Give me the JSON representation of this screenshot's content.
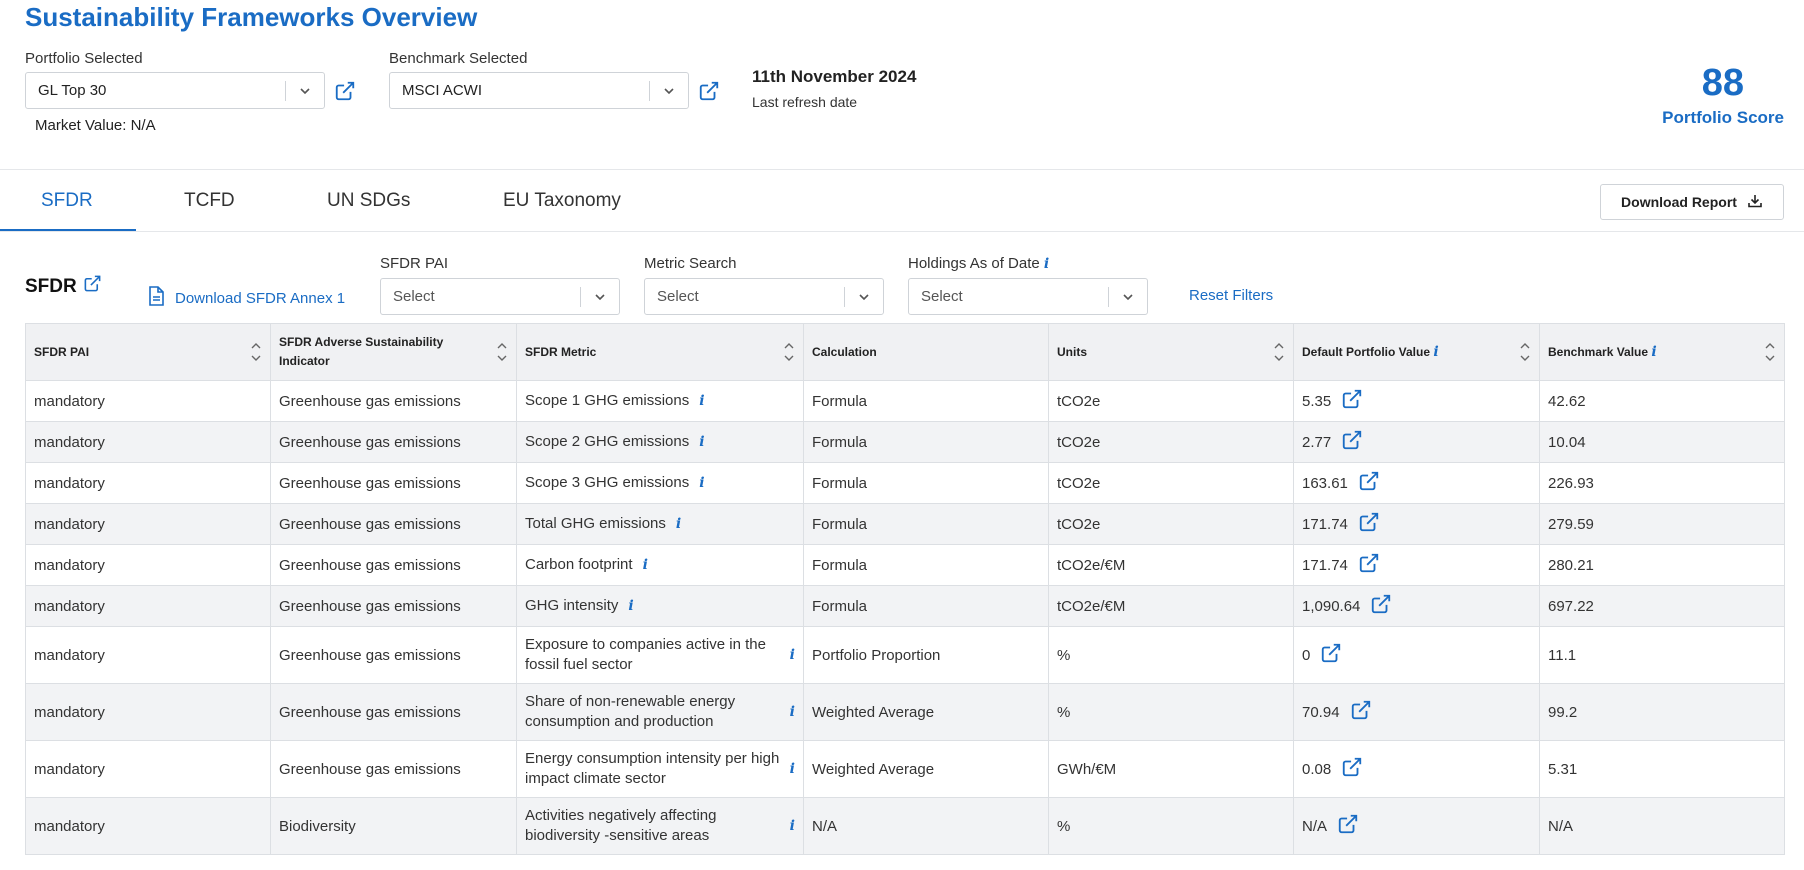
{
  "header": {
    "title": "Sustainability Frameworks Overview",
    "portfolio_label": "Portfolio Selected",
    "portfolio_value": "GL Top 30",
    "benchmark_label": "Benchmark Selected",
    "benchmark_value": "MSCI ACWI",
    "refresh_date": "11th November 2024",
    "refresh_label": "Last refresh date",
    "market_value": "Market Value: N/A",
    "score": "88",
    "score_label": "Portfolio Score"
  },
  "tabs": [
    {
      "label": "SFDR",
      "active": true
    },
    {
      "label": "TCFD",
      "active": false
    },
    {
      "label": "UN SDGs",
      "active": false
    },
    {
      "label": "EU Taxonomy",
      "active": false
    }
  ],
  "download_report_label": "Download Report",
  "section": {
    "heading": "SFDR",
    "annex_link": "Download SFDR Annex 1",
    "filters": {
      "pai_label": "SFDR PAI",
      "pai_placeholder": "Select",
      "metric_label": "Metric Search",
      "metric_placeholder": "Select",
      "holdings_label": "Holdings As of Date",
      "holdings_placeholder": "Select"
    },
    "reset_filters": "Reset Filters"
  },
  "icons": {
    "external_link": "external-link-icon",
    "chevron": "chevron-down-icon",
    "document": "document-icon",
    "download": "download-icon",
    "info": "info-icon",
    "sort": "sort-icon"
  },
  "colors": {
    "accent": "#1a6cc4",
    "header_bg": "#f0f1f3",
    "row_alt": "#f2f3f5",
    "border": "#dcdfe3"
  },
  "info_glyph": "i",
  "table": {
    "columns": [
      "SFDR PAI",
      "SFDR Adverse Sustainability Indicator",
      "SFDR Metric",
      "Calculation",
      "Units",
      "Default Portfolio Value",
      "Benchmark Value"
    ],
    "rows": [
      {
        "pai": "mandatory",
        "indicator": "Greenhouse gas emissions",
        "metric": "Scope 1 GHG emissions",
        "calc": "Formula",
        "units": "tCO2e",
        "portfolio": "5.35",
        "benchmark": "42.62"
      },
      {
        "pai": "mandatory",
        "indicator": "Greenhouse gas emissions",
        "metric": "Scope 2 GHG emissions",
        "calc": "Formula",
        "units": "tCO2e",
        "portfolio": "2.77",
        "benchmark": "10.04"
      },
      {
        "pai": "mandatory",
        "indicator": "Greenhouse gas emissions",
        "metric": "Scope 3 GHG emissions",
        "calc": "Formula",
        "units": "tCO2e",
        "portfolio": "163.61",
        "benchmark": "226.93"
      },
      {
        "pai": "mandatory",
        "indicator": "Greenhouse gas emissions",
        "metric": "Total GHG emissions",
        "calc": "Formula",
        "units": "tCO2e",
        "portfolio": "171.74",
        "benchmark": "279.59"
      },
      {
        "pai": "mandatory",
        "indicator": "Greenhouse gas emissions",
        "metric": "Carbon footprint",
        "calc": "Formula",
        "units": "tCO2e/€M",
        "portfolio": "171.74",
        "benchmark": "280.21"
      },
      {
        "pai": "mandatory",
        "indicator": "Greenhouse gas emissions",
        "metric": "GHG intensity",
        "calc": "Formula",
        "units": "tCO2e/€M",
        "portfolio": "1,090.64",
        "benchmark": "697.22"
      },
      {
        "pai": "mandatory",
        "indicator": "Greenhouse gas emissions",
        "metric": "Exposure to companies active in the fossil fuel sector",
        "calc": "Portfolio Proportion",
        "units": "%",
        "portfolio": "0",
        "benchmark": "11.1"
      },
      {
        "pai": "mandatory",
        "indicator": "Greenhouse gas emissions",
        "metric": "Share of non-renewable energy consumption and production",
        "calc": "Weighted Average",
        "units": "%",
        "portfolio": "70.94",
        "benchmark": "99.2"
      },
      {
        "pai": "mandatory",
        "indicator": "Greenhouse gas emissions",
        "metric": "Energy consumption intensity per high impact climate sector",
        "calc": "Weighted Average",
        "units": "GWh/€M",
        "portfolio": "0.08",
        "benchmark": "5.31"
      },
      {
        "pai": "mandatory",
        "indicator": "Biodiversity",
        "metric": "Activities negatively affecting biodiversity -sensitive areas",
        "calc": "N/A",
        "units": "%",
        "portfolio": "N/A",
        "benchmark": "N/A"
      }
    ]
  }
}
